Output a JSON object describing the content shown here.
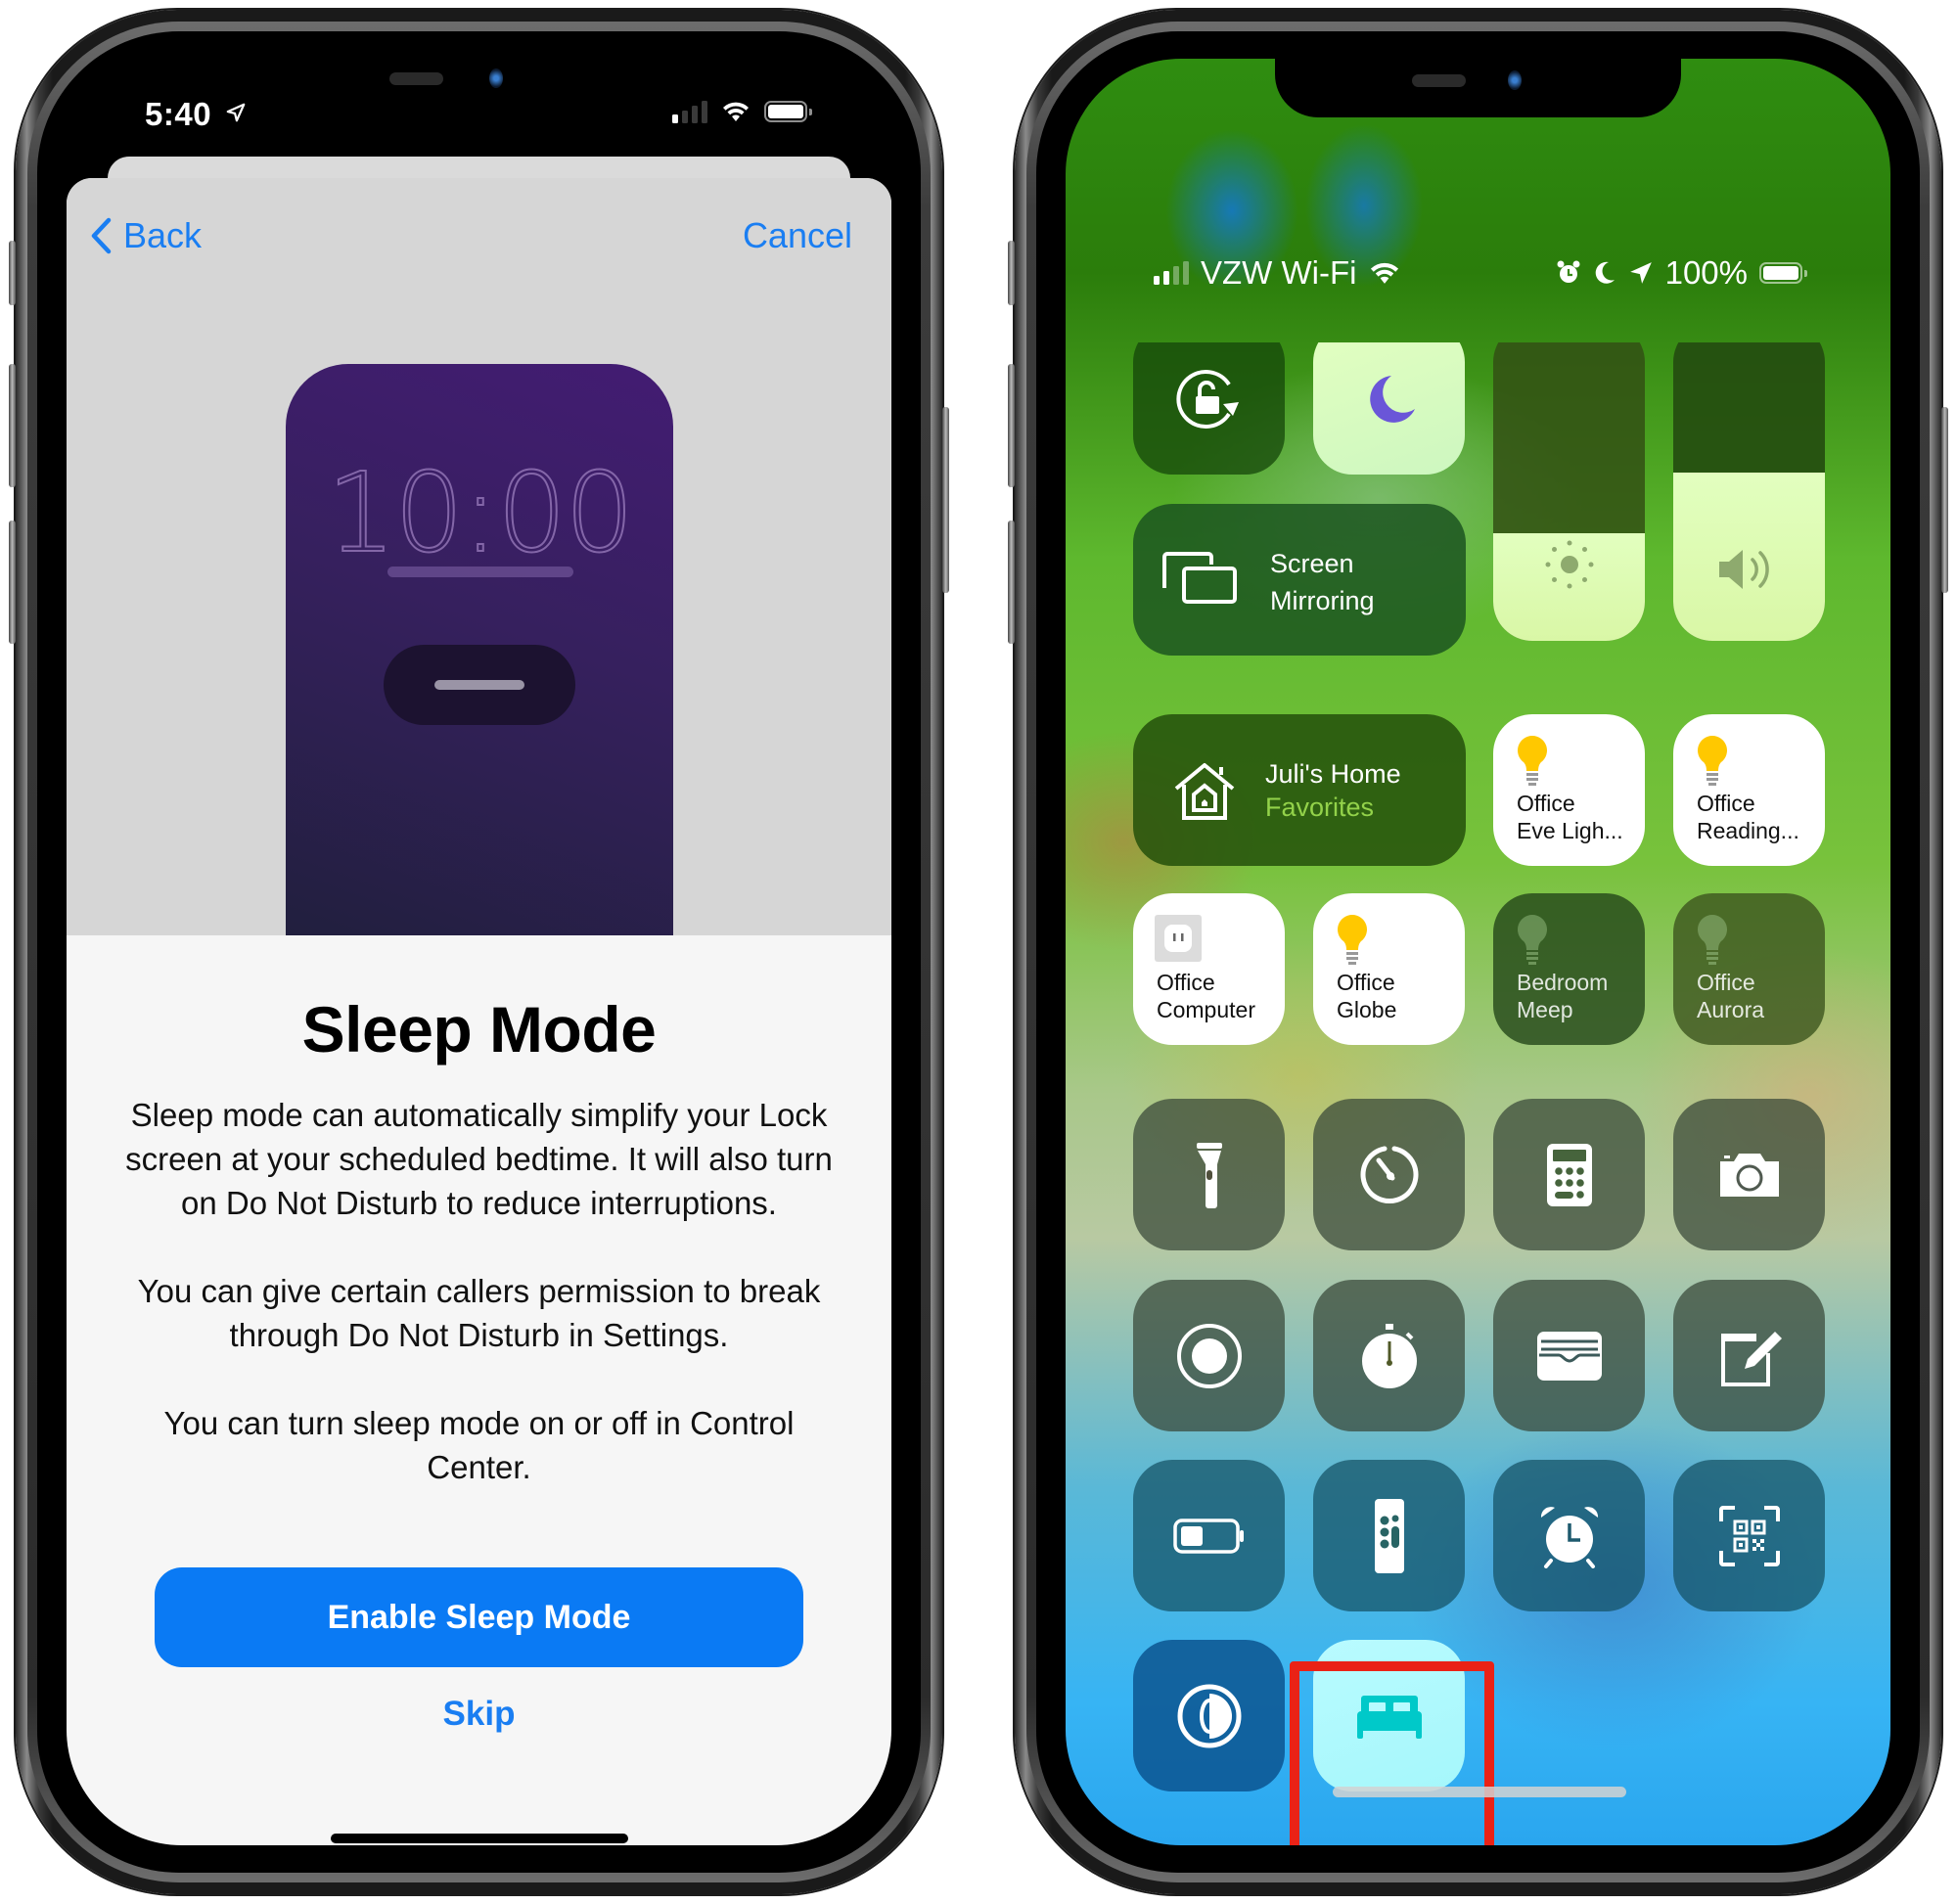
{
  "left_phone": {
    "status_bar": {
      "time": "5:40",
      "location_icon": "location-arrow-icon",
      "signal_bars_active": 1,
      "signal_bars_total": 4,
      "wifi_icon": "wifi-icon",
      "battery_icon": "battery-icon"
    },
    "nav": {
      "back_label": "Back",
      "cancel_label": "Cancel"
    },
    "illustration": {
      "lock_screen_time": "10:00"
    },
    "title": "Sleep Mode",
    "body": [
      "Sleep mode can automatically simplify your Lock screen at your scheduled bedtime. It will also turn on Do Not Disturb to reduce interruptions.",
      "You can give certain callers permission to break through Do Not Disturb in Settings.",
      "You can turn sleep mode on or off in Control Center."
    ],
    "primary_button": "Enable Sleep Mode",
    "secondary_button": "Skip",
    "colors": {
      "accent": "#0a7af4"
    }
  },
  "right_phone": {
    "status_bar": {
      "carrier": "VZW Wi-Fi",
      "signal_bars_active": 2,
      "signal_bars_total": 4,
      "battery_percent": "100%",
      "icons": [
        "alarm-icon",
        "moon-icon",
        "location-arrow-icon",
        "battery-icon"
      ]
    },
    "control_center": {
      "rotation_lock": {
        "icon": "rotation-lock-icon",
        "state": "off"
      },
      "do_not_disturb": {
        "icon": "moon-icon",
        "state": "on"
      },
      "screen_mirroring": {
        "icon": "screen-mirroring-icon",
        "label_line1": "Screen",
        "label_line2": "Mirroring"
      },
      "brightness": {
        "icon": "sun-icon",
        "level": 0.34
      },
      "volume": {
        "icon": "speaker-icon",
        "level": 0.53
      },
      "home": {
        "icon": "home-icon",
        "title": "Juli's Home",
        "subtitle": "Favorites"
      },
      "accessories": [
        {
          "line1": "Office",
          "line2": "Eve Ligh...",
          "icon": "lightbulb-icon",
          "state": "on"
        },
        {
          "line1": "Office",
          "line2": "Reading...",
          "icon": "lightbulb-icon",
          "state": "on"
        },
        {
          "line1": "Office",
          "line2": "Computer",
          "icon": "outlet-icon",
          "state": "on"
        },
        {
          "line1": "Office",
          "line2": "Globe",
          "icon": "lightbulb-icon",
          "state": "on"
        },
        {
          "line1": "Bedroom",
          "line2": "Meep",
          "icon": "lightbulb-icon",
          "state": "off"
        },
        {
          "line1": "Office",
          "line2": "Aurora",
          "icon": "lightbulb-icon",
          "state": "off"
        }
      ],
      "tools": [
        {
          "name": "flashlight",
          "icon": "flashlight-icon"
        },
        {
          "name": "timer",
          "icon": "timer-icon"
        },
        {
          "name": "calculator",
          "icon": "calculator-icon"
        },
        {
          "name": "camera",
          "icon": "camera-icon"
        },
        {
          "name": "screen-recording",
          "icon": "record-icon"
        },
        {
          "name": "stopwatch",
          "icon": "stopwatch-icon"
        },
        {
          "name": "wallet",
          "icon": "wallet-icon"
        },
        {
          "name": "notes",
          "icon": "notes-icon"
        },
        {
          "name": "low-power-mode",
          "icon": "low-battery-icon"
        },
        {
          "name": "apple-tv-remote",
          "icon": "remote-icon"
        },
        {
          "name": "alarm",
          "icon": "alarm-icon"
        },
        {
          "name": "qr-code-scanner",
          "icon": "qr-code-icon"
        },
        {
          "name": "dark-mode",
          "icon": "dark-mode-icon"
        },
        {
          "name": "sleep-mode",
          "icon": "bed-icon",
          "state": "on",
          "highlighted": true
        }
      ],
      "colors": {
        "highlight_box": "#ea2216",
        "bed_icon": "#00c9c9",
        "moon": "#6a56d8",
        "bulb_on": "#ffc800"
      }
    }
  }
}
